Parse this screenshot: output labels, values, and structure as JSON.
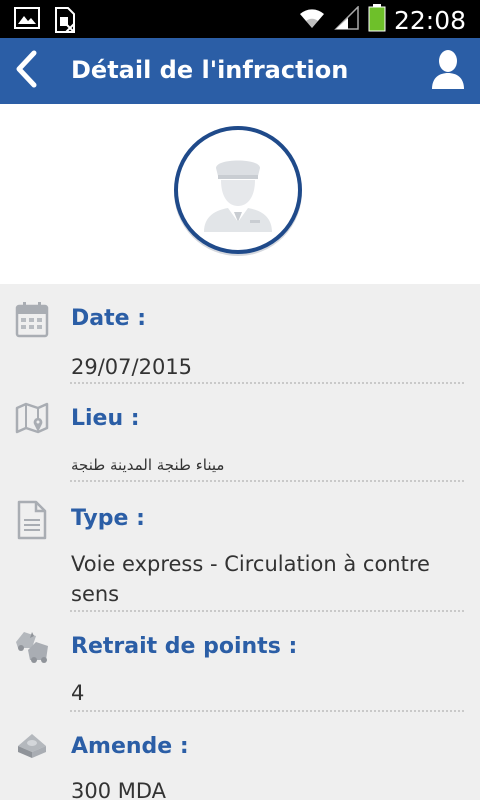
{
  "status_bar": {
    "time": "22:08",
    "icons": [
      "image-icon",
      "sim-card-icon",
      "wifi-icon",
      "signal-icon",
      "battery-icon"
    ],
    "battery_color": "#6ec02a"
  },
  "app_bar": {
    "title": "Détail de l'infraction",
    "color": "#2b5ea6",
    "back_icon": "chevron-left-icon",
    "user_icon": "user-icon"
  },
  "avatar": {
    "icon": "police-officer-icon"
  },
  "details": {
    "date": {
      "label": "Date :",
      "value": "29/07/2015",
      "icon": "calendar-icon"
    },
    "lieu": {
      "label": "Lieu :",
      "value": "ميناء طنجة المدينة طنجة",
      "icon": "map-pin-icon"
    },
    "type": {
      "label": "Type :",
      "value": "Voie express - Circulation à contre sens",
      "icon": "document-icon"
    },
    "points": {
      "label": "Retrait de points :",
      "value": "4",
      "icon": "car-crash-icon"
    },
    "amende": {
      "label": "Amende :",
      "value": "300 MDA",
      "icon": "money-icon"
    }
  }
}
